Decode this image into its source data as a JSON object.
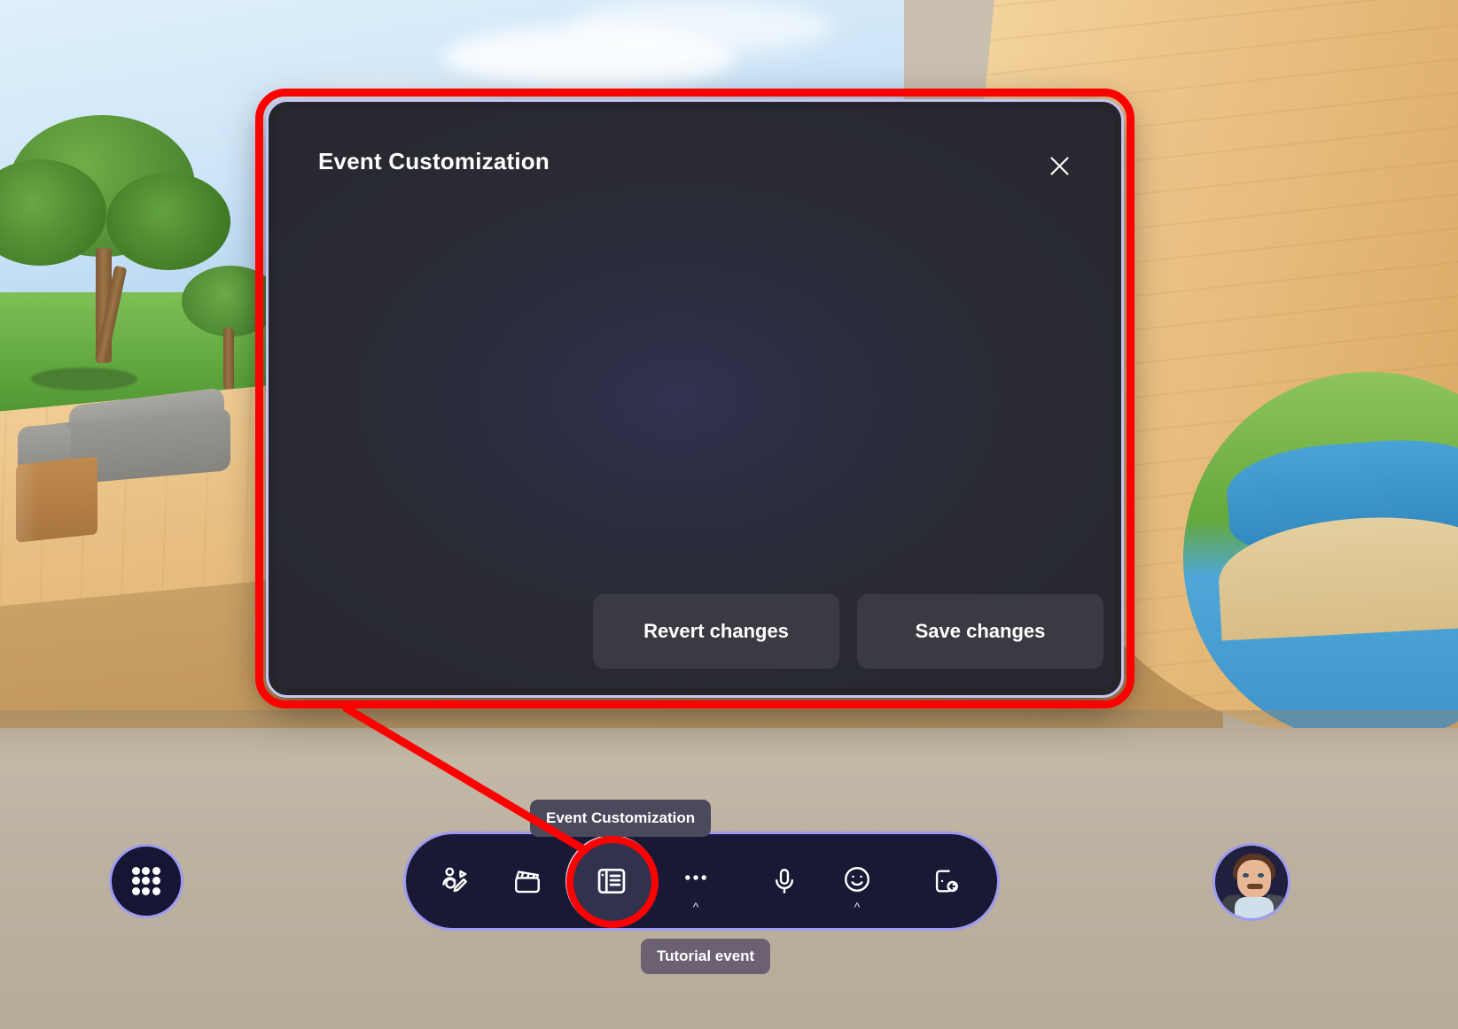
{
  "scene": {
    "description": "3d-virtual-environment-background"
  },
  "dialog": {
    "title": "Event Customization",
    "close_icon": "close-icon",
    "buttons": {
      "revert": "Revert changes",
      "save": "Save changes"
    }
  },
  "annotation": {
    "highlight_color": "#ff0000",
    "target": "event-customization-toolbar-button"
  },
  "tooltip": {
    "event_customization": "Event Customization"
  },
  "badge": {
    "tutorial_event": "Tutorial event"
  },
  "toolbar": {
    "accent_border": "#9f9bf0",
    "background": "#191936",
    "items": [
      {
        "name": "avatar-edit-icon",
        "label": "Customize avatar",
        "caret": false
      },
      {
        "name": "video-clapperboard-icon",
        "label": "Video effects",
        "caret": false
      },
      {
        "name": "event-customization-icon",
        "label": "Event Customization",
        "caret": false,
        "active": true
      },
      {
        "name": "more-options-icon",
        "label": "More",
        "caret": true
      },
      {
        "name": "microphone-icon",
        "label": "Mute",
        "caret": false
      },
      {
        "name": "emoji-icon",
        "label": "Reactions",
        "caret": true
      },
      {
        "name": "leave-icon",
        "label": "Leave",
        "caret": false
      }
    ]
  },
  "apps_button": {
    "name": "apps-grid-button",
    "label": "Apps"
  },
  "avatar": {
    "name": "user-avatar",
    "label": "Profile"
  }
}
